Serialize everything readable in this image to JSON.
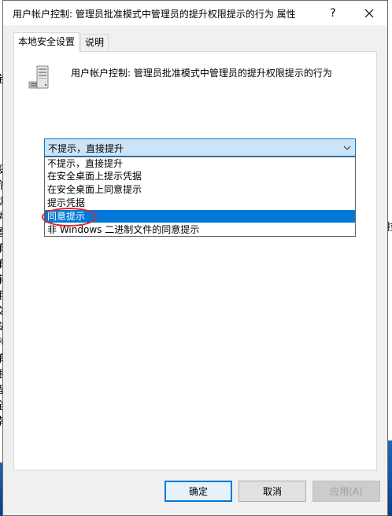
{
  "window": {
    "title": "用户帐户控制: 管理员批准模式中管理员的提升权限提示的行为 属性",
    "help": "?",
    "close_icon": "close-icon"
  },
  "tabs": [
    {
      "label": "本地安全设置",
      "active": true
    },
    {
      "label": "说明",
      "active": false
    }
  ],
  "policy": {
    "icon": "policy-server-icon",
    "heading": "用户帐户控制: 管理员批准模式中管理员的提升权限提示的行为"
  },
  "combo": {
    "value": "不提示，直接提升",
    "arrow_icon": "chevron-down-icon"
  },
  "dropdown": {
    "options": [
      "不提示，直接提升",
      "在安全桌面上提示凭据",
      "在安全桌面上同意提示",
      "提示凭据",
      "同意提示",
      "非 Windows 二进制文件的同意提示"
    ],
    "highlighted_index": 4,
    "annotation_color": "#e2242c"
  },
  "buttons": {
    "ok": "确定",
    "cancel": "取消",
    "apply": "应用(A)"
  },
  "colors": {
    "accent": "#0078d7",
    "combo_bg": "#cce4f7"
  }
}
